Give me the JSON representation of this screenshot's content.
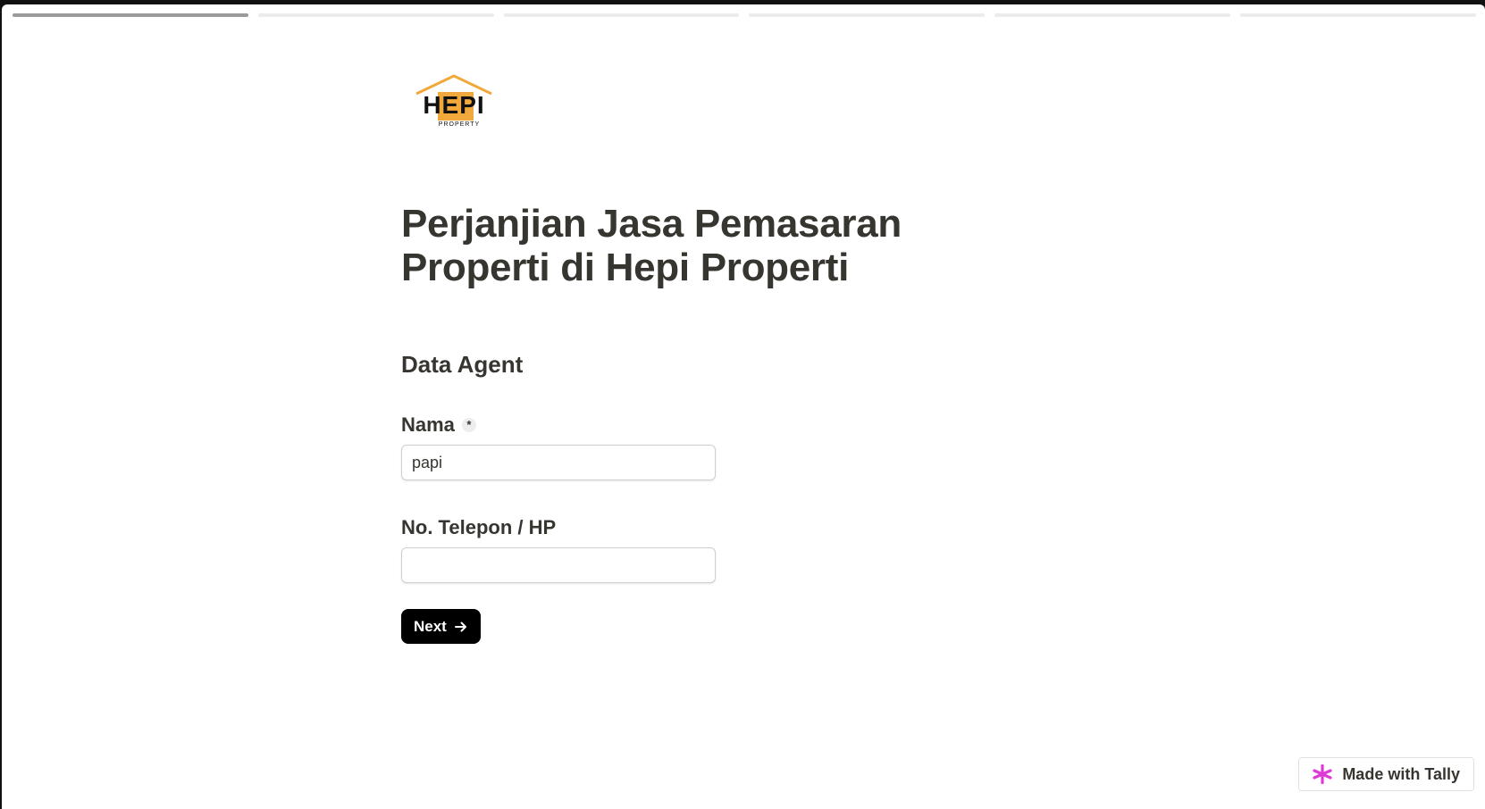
{
  "progress": {
    "total_steps": 6,
    "current_step": 1
  },
  "brand": {
    "logo_letters": "HEPI",
    "logo_sub": "PROPERTY",
    "logo_accent": "#f2a93b"
  },
  "form": {
    "title": "Perjanjian Jasa Pemasaran Properti di Hepi Properti",
    "section_title": "Data Agent",
    "fields": [
      {
        "label": "Nama",
        "required": true,
        "value": "papi"
      },
      {
        "label": "No. Telepon / HP",
        "required": false,
        "value": ""
      }
    ],
    "required_mark": "*",
    "next_label": "Next",
    "next_icon": "arrow-right-icon"
  },
  "footer": {
    "badge_label": "Made with Tally",
    "badge_icon": "tally-asterisk-icon",
    "badge_color": "#e03ad6"
  }
}
